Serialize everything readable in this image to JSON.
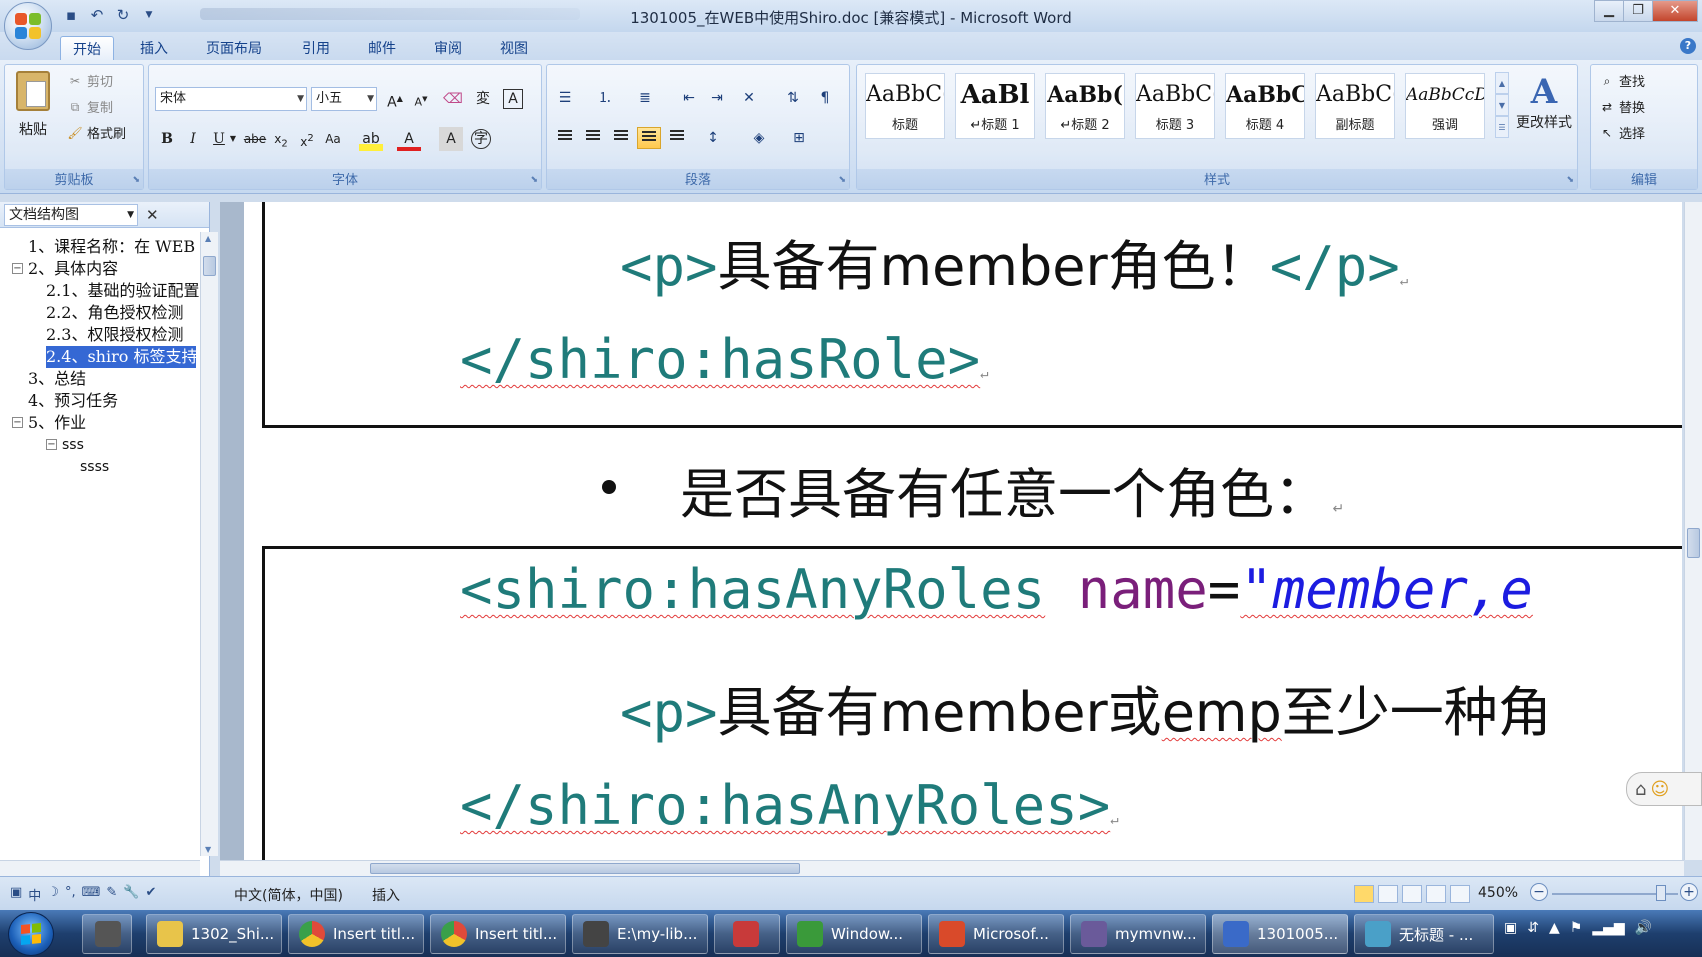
{
  "window": {
    "title": "1301005_在WEB中使用Shiro.doc [兼容模式] - Microsoft Word"
  },
  "qat": {
    "save_icon": "save-icon",
    "undo_icon": "undo-icon",
    "redo_icon": "redo-icon"
  },
  "tabs": [
    "开始",
    "插入",
    "页面布局",
    "引用",
    "邮件",
    "审阅",
    "视图"
  ],
  "clipboard": {
    "paste": "粘贴",
    "cut": "剪切",
    "copy": "复制",
    "format_painter": "格式刷",
    "label": "剪贴板"
  },
  "font": {
    "family": "宋体",
    "size": "小五",
    "label": "字体"
  },
  "paragraph": {
    "label": "段落"
  },
  "styles": {
    "items": [
      {
        "sample": "AaBbC(",
        "name": "标题"
      },
      {
        "sample": "AaBl",
        "name": "↵标题 1"
      },
      {
        "sample": "AaBb(",
        "name": "↵标题 2"
      },
      {
        "sample": "AaBbC(",
        "name": "标题 3"
      },
      {
        "sample": "AaBbC(",
        "name": "标题 4"
      },
      {
        "sample": "AaBbC(",
        "name": "副标题"
      },
      {
        "sample": "AaBbCcD(",
        "name": "强调"
      }
    ],
    "change_styles": "更改样式",
    "label": "样式"
  },
  "editing": {
    "find": "查找",
    "replace": "替换",
    "select": "选择",
    "label": "编辑"
  },
  "nav": {
    "mode": "文档结构图",
    "items": [
      "1、课程名称：在 WEB",
      "2、具体内容",
      "2.1、基础的验证配置",
      "2.2、角色授权检测",
      "2.3、权限授权检测",
      "2.4、shiro 标签支持",
      "3、总结",
      "4、预习任务",
      "5、作业",
      "sss",
      "ssss"
    ]
  },
  "document": {
    "line1": {
      "open": "<p>",
      "text": "具备有member角色！",
      "close": "</p>"
    },
    "line2": "</shiro:hasRole>",
    "bullet": "是否具备有任意一个角色：",
    "line3": {
      "tag": "<shiro:hasAnyRoles",
      "attr": "name",
      "eq": "=",
      "value": "\"member,e"
    },
    "line4": {
      "open": "<p>",
      "text1": "具备有member或",
      "text2": "emp",
      "text3": "至少一种角"
    },
    "line5": "</shiro:hasAnyRoles>"
  },
  "status": {
    "language": "中文(简体，中国)",
    "mode": "插入",
    "zoom": "450%"
  },
  "taskbar": {
    "items": [
      {
        "label": "1302_Shi...",
        "color": "#e8c44a"
      },
      {
        "label": "Insert titl...",
        "color": "#e04a3a"
      },
      {
        "label": "Insert titl...",
        "color": "#e04a3a"
      },
      {
        "label": "E:\\my-lib...",
        "color": "#444444"
      },
      {
        "label": "Window...",
        "color": "#3a9a3a"
      },
      {
        "label": "Microsof...",
        "color": "#d94a2a"
      },
      {
        "label": "mymvnw...",
        "color": "#6a5a9a"
      },
      {
        "label": "1301005...",
        "color": "#3a6ac8"
      },
      {
        "label": "无标题 - ...",
        "color": "#4aa0c8"
      }
    ]
  }
}
